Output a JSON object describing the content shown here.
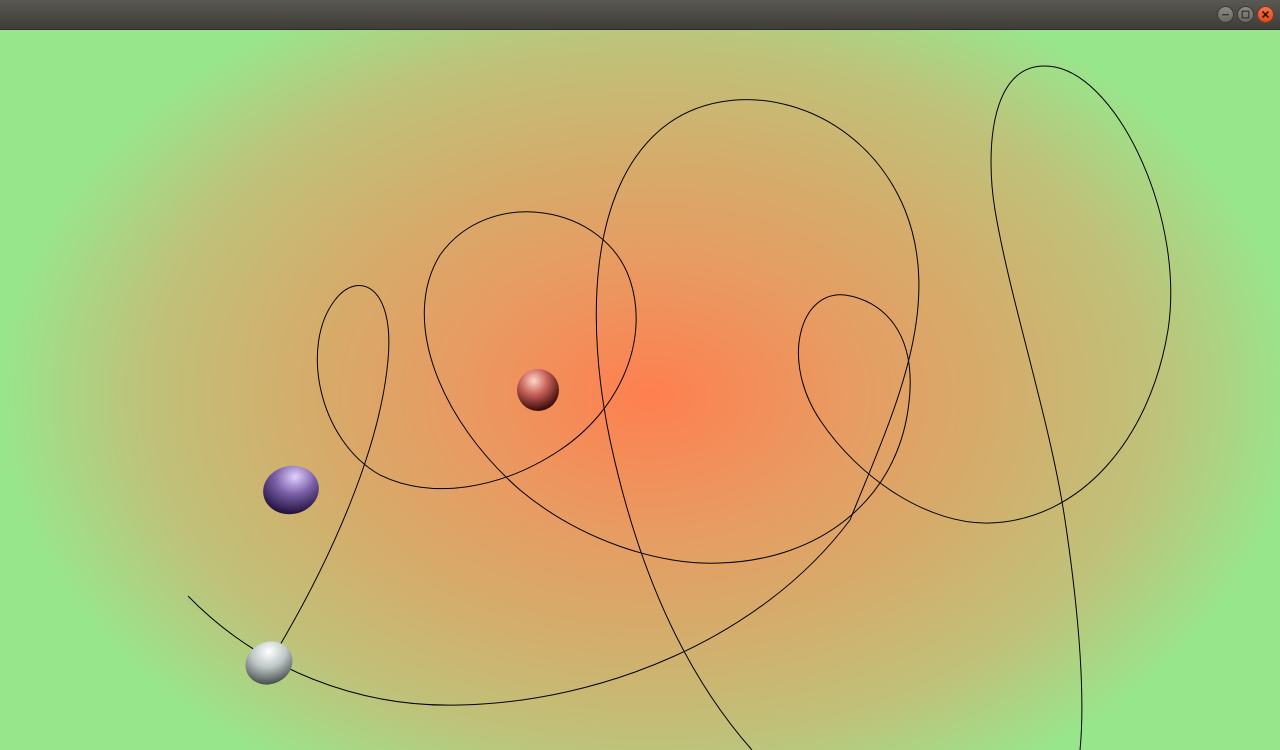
{
  "window": {
    "title": "",
    "controls": {
      "minimize_icon": "minimize-icon",
      "maximize_icon": "maximize-icon",
      "close_icon": "close-icon"
    }
  },
  "scene": {
    "background_center_color": "#ff7f50",
    "background_edge_color": "#98e68c",
    "trail_color": "#000000",
    "spheres": [
      {
        "name": "red-sphere",
        "highlight": "#ffd6c8",
        "base": "#c8625a",
        "shadow": "#3a0a06"
      },
      {
        "name": "purple-sphere",
        "highlight": "#e2d2ff",
        "base": "#7a5fa8",
        "shadow": "#1a0a33"
      },
      {
        "name": "white-sphere",
        "highlight": "#ffffff",
        "base": "#bfc9c8",
        "shadow": "#3c4443"
      }
    ]
  }
}
